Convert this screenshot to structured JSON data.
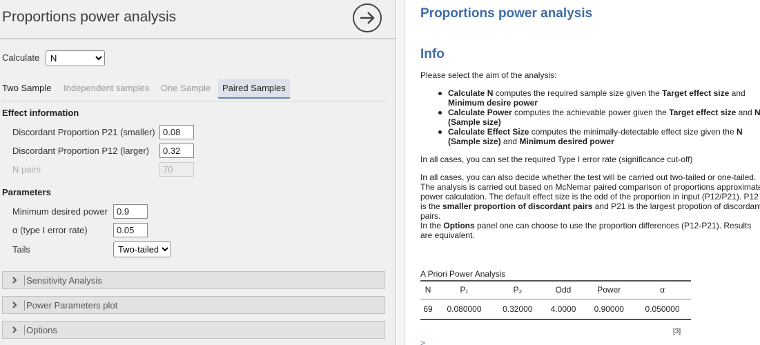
{
  "left": {
    "title": "Proportions power analysis",
    "calculate_label": "Calculate",
    "calculate_value": "N",
    "tabs": [
      "Two Sample",
      "Independent samples",
      "One Sample",
      "Paired Samples"
    ],
    "effect_heading": "Effect information",
    "p21_label": "Discordant Proportion P21 (smaller)",
    "p21_value": "0.08",
    "p12_label": "Discordant Proportion P12 (larger)",
    "p12_value": "0.32",
    "npairs_label": "N pairs",
    "npairs_value": "70",
    "params_heading": "Parameters",
    "power_label": "Minimum desired power",
    "power_value": "0.9",
    "alpha_label": "α (type I error rate)",
    "alpha_value": "0.05",
    "tails_label": "Tails",
    "tails_value": "Two-tailed",
    "panels": [
      "Sensitivity Analysis",
      "Power Parameters plot",
      "Options"
    ]
  },
  "right": {
    "title": "Proportions power analysis",
    "info_heading": "Info",
    "intro": "Please select the aim of the analysis:",
    "b1_bold1": "Calculate N",
    "b1_text1": " computes the required sample size given the ",
    "b1_bold2": "Target effect size",
    "b1_text2": " and",
    "b1_line2": "Minimum desire power",
    "b2_bold1": "Calculate Power",
    "b2_text1": " computes the achievable power given the ",
    "b2_bold2": "Target effect size",
    "b2_text2": " and ",
    "b2_bold3": "N",
    "b2_line2": "(Sample size)",
    "b3_bold1": "Calculate Effect Size",
    "b3_text1": " computes the minimally-detectable effect size given the ",
    "b3_bold2": "N",
    "b3_line2_bold": "(Sample size)",
    "b3_line2_text": " and ",
    "b3_line2_bold2": "Minimum desired power",
    "para1": "In all cases, you can set the required Type I error rate (significance cut-off)",
    "para2_l1": "In all cases, you can also decide whether the test will be carried out two-tailed or one-tailed.",
    "para2_l2": "The analysis is carried out based on McNemar paired comparison of proportions approximate",
    "para2_l3": "power calculation. The default effect size is the odd of the proportion in input (P12/P21). P12",
    "para2_l4a": "is the ",
    "para2_l4b": "smaller proportion of discordant pairs",
    "para2_l4c": " and P21 is the largest propotion of discordant",
    "para2_l5": "pairs.",
    "para2_l6a": "In the ",
    "para2_l6b": "Options",
    "para2_l6c": " panel one can choose to use the proportion differences (P12-P21). Results",
    "para2_l7": "are equivalent.",
    "table_caption": "A Priori Power Analysis",
    "table_headers": [
      "N",
      "P₁",
      "P₂",
      "Odd",
      "Power",
      "α"
    ],
    "table_row": [
      "69",
      "0.080000",
      "0.32000",
      "4.0000",
      "0.90000",
      "0.050000"
    ],
    "ref": "[3]",
    "prompt": ">"
  }
}
